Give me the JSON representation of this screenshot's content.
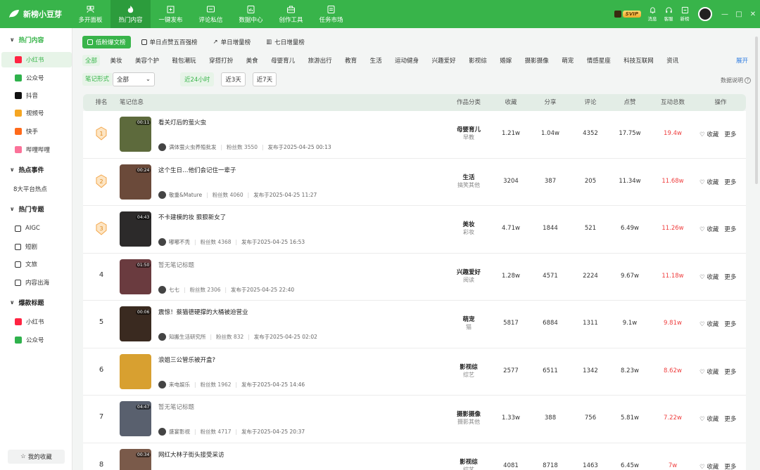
{
  "app": {
    "name": "新榜小豆芽"
  },
  "nav": [
    {
      "label": "多开面板",
      "icon": "multi-panel-icon"
    },
    {
      "label": "热门内容",
      "icon": "hot-content-icon",
      "active": true
    },
    {
      "label": "一键发布",
      "icon": "publish-icon"
    },
    {
      "label": "评论私信",
      "icon": "comment-icon"
    },
    {
      "label": "数据中心",
      "icon": "data-center-icon"
    },
    {
      "label": "创作工具",
      "icon": "creation-tools-icon"
    },
    {
      "label": "任务市场",
      "icon": "task-market-icon"
    }
  ],
  "topright": {
    "svip": "SVIP",
    "tools": [
      "消息",
      "客服",
      "新榜"
    ]
  },
  "sidebar": {
    "group1": "热门内容",
    "g1items": [
      "小红书",
      "公众号",
      "抖音",
      "视频号",
      "快手",
      "哔哩哔哩"
    ],
    "group2": "热点事件",
    "g2items": [
      "8大平台热点"
    ],
    "group3": "热门专题",
    "g3items": [
      "AIGC",
      "短剧",
      "文旅",
      "内容出海"
    ],
    "group4": "爆款标题",
    "g4items": [
      "小红书",
      "公众号"
    ],
    "favorites": "我的收藏"
  },
  "subtabs": [
    "低粉爆文榜",
    "单日点赞五百强榜",
    "单日增量榜",
    "七日增量榜"
  ],
  "categories": [
    "全部",
    "美妆",
    "美容个护",
    "鞋包潮玩",
    "穿搭打扮",
    "美食",
    "母婴育儿",
    "旅游出行",
    "教育",
    "生活",
    "运动健身",
    "兴趣爱好",
    "影视综",
    "婚嫁",
    "摄影摄像",
    "萌宠",
    "情感星座",
    "科技互联网",
    "资讯"
  ],
  "expand": "展开",
  "filters": {
    "label": "笔记形式",
    "select": "全部",
    "times": [
      "近24小时",
      "近3天",
      "近7天"
    ],
    "note": "数据说明"
  },
  "table": {
    "headers": [
      "排名",
      "笔记信息",
      "作品分类",
      "收藏",
      "分享",
      "评论",
      "点赞",
      "互动总数",
      "操作"
    ],
    "action_fav": "收藏",
    "action_more": "更多",
    "fans_label": "粉丝数",
    "pub_label": "发布于",
    "rows": [
      {
        "rank": "1",
        "duration": "00:11",
        "title": "看关灯后的萤火虫",
        "author": "满体萤火虫养殖批发",
        "fans": "3550",
        "date": "2025-04-25 00:13",
        "cat1": "母婴育儿",
        "cat2": "早教",
        "fav": "1.21w",
        "share": "1.04w",
        "comment": "4352",
        "like": "17.75w",
        "total": "19.4w",
        "thumb": "#5d6a3c"
      },
      {
        "rank": "2",
        "duration": "00:24",
        "title": "这个生日…他们会记住一辈子",
        "author": "敬重&Mature",
        "fans": "4060",
        "date": "2025-04-25 11:27",
        "cat1": "生活",
        "cat2": "搞笑其他",
        "fav": "3204",
        "share": "387",
        "comment": "205",
        "like": "11.34w",
        "total": "11.68w",
        "thumb": "#6b4a3a"
      },
      {
        "rank": "3",
        "duration": "04:43",
        "title": "不卡建模的妆 狠狠新女了",
        "author": "嘟嘟不秃",
        "fans": "4368",
        "date": "2025-04-25 16:53",
        "cat1": "美妆",
        "cat2": "彩妆",
        "fav": "4.71w",
        "share": "1844",
        "comment": "521",
        "like": "6.49w",
        "total": "11.26w",
        "thumb": "#2c2a2a"
      },
      {
        "rank": "4",
        "duration": "01:50",
        "title": "暂无笔记标题",
        "author": "七七",
        "fans": "2306",
        "date": "2025-04-25 22:40",
        "cat1": "兴趣爱好",
        "cat2": "阅读",
        "fav": "1.28w",
        "share": "4571",
        "comment": "2224",
        "like": "9.67w",
        "total": "11.18w",
        "thumb": "#6a3b3f"
      },
      {
        "rank": "5",
        "duration": "00:06",
        "title": "震惊！蔡猫德硬撑的大桶被迫营业",
        "author": "知搬生活研究所",
        "fans": "832",
        "date": "2025-04-25 02:02",
        "cat1": "萌宠",
        "cat2": "猫",
        "fav": "5817",
        "share": "6884",
        "comment": "1311",
        "like": "9.1w",
        "total": "9.81w",
        "thumb": "#3a2a20"
      },
      {
        "rank": "6",
        "duration": "",
        "title": "浪姐三公管乐被开盒?",
        "author": "来电娱乐",
        "fans": "1962",
        "date": "2025-04-25 14:46",
        "cat1": "影视综",
        "cat2": "综艺",
        "fav": "2577",
        "share": "6511",
        "comment": "1342",
        "like": "8.23w",
        "total": "8.62w",
        "thumb": "#d8a030"
      },
      {
        "rank": "7",
        "duration": "04:47",
        "title": "暂无笔记标题",
        "author": "盛宴影视",
        "fans": "4717",
        "date": "2025-04-25 20:37",
        "cat1": "摄影摄像",
        "cat2": "摄影其他",
        "fav": "1.33w",
        "share": "388",
        "comment": "756",
        "like": "5.81w",
        "total": "7.22w",
        "thumb": "#59606e"
      },
      {
        "rank": "8",
        "duration": "00:34",
        "title": "网红大林子街头接受采访",
        "author": "",
        "fans": "",
        "date": "",
        "cat1": "影视综",
        "cat2": "综艺",
        "fav": "4081",
        "share": "8718",
        "comment": "1463",
        "like": "6.45w",
        "total": "7w",
        "thumb": "#7a5a4a"
      }
    ]
  },
  "colors": {
    "brand": "#38b44a",
    "red": "#ef3e3e",
    "link": "#2f7de1"
  }
}
